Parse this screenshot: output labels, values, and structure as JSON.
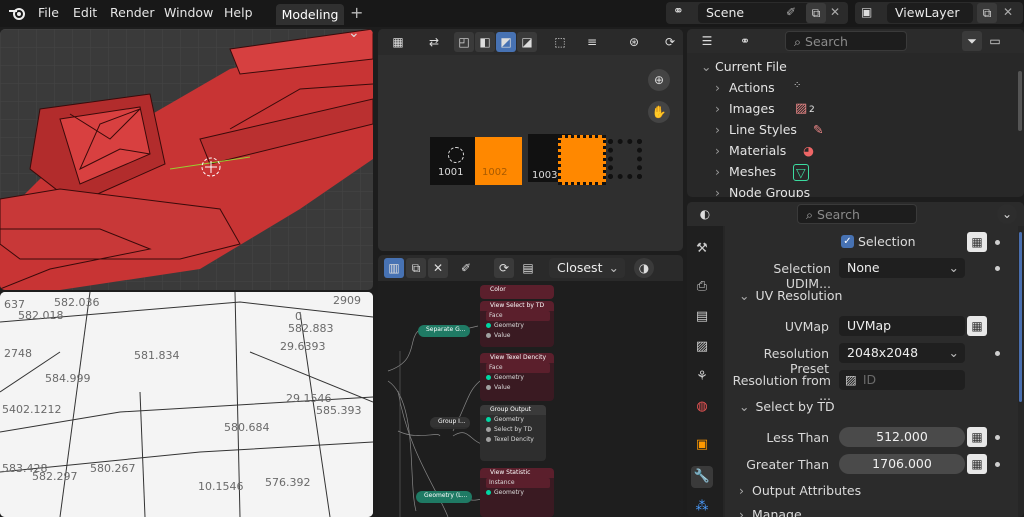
{
  "menu": {
    "file": "File",
    "edit": "Edit",
    "render": "Render",
    "window": "Window",
    "help": "Help"
  },
  "workspace_tab": "Modeling",
  "scene": {
    "name": "Scene"
  },
  "view_layer": {
    "name": "ViewLayer"
  },
  "viewport_labels": [
    "637",
    "582.036",
    "582.018",
    "2748",
    "581.834",
    "584.999",
    "582.883",
    "29.6393",
    "5402.1212",
    "29.1546",
    "580.684",
    "585.393",
    "580.267",
    "10.1546",
    "582.297",
    "583.428",
    "576.392",
    "0",
    "2909"
  ],
  "uv_editor": {
    "tile_labels": [
      "1001",
      "1002",
      "1003"
    ]
  },
  "node_editor": {
    "interpolation": "Closest",
    "nodes": {
      "color": {
        "title": "Color"
      },
      "view_select": {
        "title": "View Select by TD",
        "mode": "Face",
        "out1": "Geometry",
        "out2": "Value"
      },
      "separate": {
        "title": "Separate G..."
      },
      "view_texel": {
        "title": "View Texel Dencity",
        "mode": "Face",
        "out1": "Geometry",
        "out2": "Value"
      },
      "group_output": {
        "title": "Group Output",
        "in1": "Geometry",
        "in2": "Select by TD",
        "in3": "Texel Dencity"
      },
      "group_in": {
        "title": "Group I..."
      },
      "view_stat": {
        "title": "View Statistic",
        "mode": "Instance",
        "in1": "Geometry"
      },
      "geometry": {
        "title": "Geometry (L..."
      }
    }
  },
  "outliner": {
    "search_placeholder": "Search",
    "root": "Current File",
    "items": [
      {
        "label": "Actions",
        "badge": ""
      },
      {
        "label": "Images",
        "badge": "2"
      },
      {
        "label": "Line Styles",
        "badge": ""
      },
      {
        "label": "Materials",
        "badge": ""
      },
      {
        "label": "Meshes",
        "badge": ""
      },
      {
        "label": "Node Groups",
        "badge": ""
      }
    ]
  },
  "properties": {
    "search_placeholder": "Search",
    "selection_label": "Selection",
    "selection_udim_label": "Selection UDIM...",
    "selection_udim_value": "None",
    "uv_resolution_header": "UV Resolution",
    "uvmap_label": "UVMap",
    "uvmap_value": "UVMap",
    "resolution_preset_label": "Resolution Preset",
    "resolution_preset_value": "2048x2048",
    "resolution_from_label": "Resolution from ...",
    "resolution_from_placeholder": "ID",
    "select_by_td_header": "Select by TD",
    "less_than_label": "Less Than",
    "less_than_value": "512.000",
    "greater_than_label": "Greater Than",
    "greater_than_value": "1706.000",
    "output_attributes_header": "Output Attributes",
    "manage_header": "Manage"
  },
  "colors": {
    "accent": "#4772b3",
    "viewport_red": "#d23a3a",
    "uv_orange": "#ff8800",
    "node_teal": "#1f7a64",
    "node_maroon": "#5b1f2c"
  }
}
